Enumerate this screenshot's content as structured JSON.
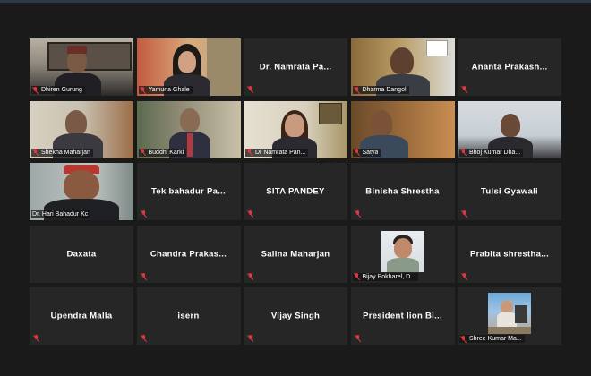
{
  "tiles": [
    {
      "name": "Dhiren Gurung",
      "video": true
    },
    {
      "name": "Yamuna Ghale",
      "video": true
    },
    {
      "name": "Dr. Namrata Pa...",
      "video": false
    },
    {
      "name": "Dharma Dangol",
      "video": true
    },
    {
      "name": "Ananta Prakash...",
      "video": false
    },
    {
      "name": "Shekha Maharjan",
      "video": true
    },
    {
      "name": "Buddhi Karki",
      "video": true
    },
    {
      "name": "Dr Namrata Pan...",
      "video": true
    },
    {
      "name": "Satya",
      "video": true
    },
    {
      "name": "Bhoj Kumar Dha...",
      "video": true
    },
    {
      "name": "Dr. Hari Bahadur Kc",
      "video": true,
      "active": true
    },
    {
      "name": "Tek bahadur Pa...",
      "video": false
    },
    {
      "name": "SITA PANDEY",
      "video": false
    },
    {
      "name": "Binisha Shrestha",
      "video": false
    },
    {
      "name": "Tulsi Gyawali",
      "video": false
    },
    {
      "name": "Daxata",
      "video": false
    },
    {
      "name": "Chandra Prakas...",
      "video": false
    },
    {
      "name": "Salina Maharjan",
      "video": false
    },
    {
      "name": "Bijay Pokharel, D...",
      "video": "photo"
    },
    {
      "name": "Prabita shrestha...",
      "video": false
    },
    {
      "name": "Upendra Malla",
      "video": false
    },
    {
      "name": "isern",
      "video": false
    },
    {
      "name": "Vijay Singh",
      "video": false
    },
    {
      "name": "President lion Bi...",
      "video": false
    },
    {
      "name": "Shree Kumar Ma...",
      "video": "photo"
    }
  ],
  "colors": {
    "active_speaker_border": "#b9d65a",
    "muted_icon": "#e0383e",
    "tile_bg": "#262626"
  },
  "icons": {
    "muted": "mic-off-icon"
  }
}
